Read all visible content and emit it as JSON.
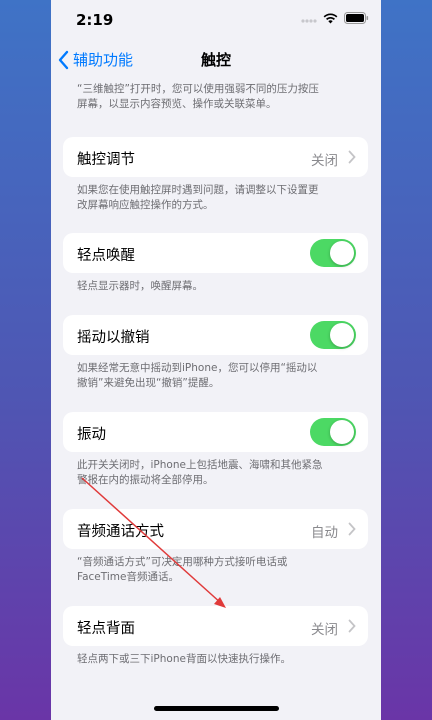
{
  "status_bar": {
    "time": "2:19"
  },
  "nav": {
    "back_label": "辅助功能",
    "title": "触控"
  },
  "intro": {
    "line1": "“三维触控”打开时，您可以使用强弱不同的压力按压",
    "line2": "屏幕，以显示内容预览、操作或关联菜单。"
  },
  "touch_accommodations": {
    "label": "触控调节",
    "value": "关闭",
    "footer_line1": "如果您在使用触控屏时遇到问题，请调整以下设置更",
    "footer_line2": "改屏幕响应触控操作的方式。"
  },
  "tap_to_wake": {
    "label": "轻点唤醒",
    "on": true,
    "footer_line1": "轻点显示器时，唤醒屏幕。"
  },
  "shake_to_undo": {
    "label": "摇动以撤销",
    "on": true,
    "footer_line1": "如果经常无意中摇动到iPhone，您可以停用“摇动以",
    "footer_line2": "撤销”来避免出现“撤销”提醒。"
  },
  "vibration": {
    "label": "振动",
    "on": true,
    "footer_line1": "此开关关闭时，iPhone上包括地震、海啸和其他紧急",
    "footer_line2": "警报在内的振动将全部停用。"
  },
  "call_audio_routing": {
    "label": "音频通话方式",
    "value": "自动",
    "footer_line1": "“音频通话方式”可决定用哪种方式接听电话或",
    "footer_line2": "FaceTime音频通话。"
  },
  "back_tap": {
    "label": "轻点背面",
    "value": "关闭",
    "footer_line1": "轻点两下或三下iPhone背面以快速执行操作。"
  },
  "colors": {
    "accent": "#007aff",
    "toggle_on": "#4cd964",
    "annotation_arrow": "#e03a3a"
  }
}
